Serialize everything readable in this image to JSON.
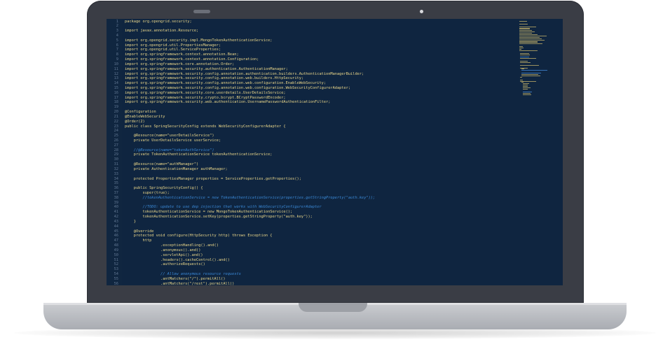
{
  "lines": [
    [
      "1",
      "package org.opengrid.security;",
      "code"
    ],
    [
      "2",
      "",
      "code"
    ],
    [
      "3",
      "import javax.annotation.Resource;",
      "code"
    ],
    [
      "4",
      "",
      "code"
    ],
    [
      "5",
      "import org.opengrid.security.impl.MongoTokenAuthenticationService;",
      "code"
    ],
    [
      "6",
      "import org.opengrid.util.PropertiesManager;",
      "code"
    ],
    [
      "7",
      "import org.opengrid.util.ServiceProperties;",
      "code"
    ],
    [
      "8",
      "import org.springframework.context.annotation.Bean;",
      "code"
    ],
    [
      "9",
      "import org.springframework.context.annotation.Configuration;",
      "code"
    ],
    [
      "10",
      "import org.springframework.core.annotation.Order;",
      "code"
    ],
    [
      "11",
      "import org.springframework.security.authentication.AuthenticationManager;",
      "code"
    ],
    [
      "12",
      "import org.springframework.security.config.annotation.authentication.builders.AuthenticationManagerBuilder;",
      "code"
    ],
    [
      "13",
      "import org.springframework.security.config.annotation.web.builders.HttpSecurity;",
      "code"
    ],
    [
      "14",
      "import org.springframework.security.config.annotation.web.configuration.EnableWebSecurity;",
      "code"
    ],
    [
      "15",
      "import org.springframework.security.config.annotation.web.configuration.WebSecurityConfigurerAdapter;",
      "code"
    ],
    [
      "16",
      "import org.springframework.security.core.userdetails.UserDetailsService;",
      "code"
    ],
    [
      "17",
      "import org.springframework.security.crypto.bcrypt.BCryptPasswordEncoder;",
      "code"
    ],
    [
      "18",
      "import org.springframework.security.web.authentication.UsernamePasswordAuthenticationFilter;",
      "code"
    ],
    [
      "19",
      "",
      "code"
    ],
    [
      "20",
      "@Configuration",
      "code"
    ],
    [
      "21",
      "@EnableWebSecurity",
      "code"
    ],
    [
      "22",
      "@Order(2)",
      "code"
    ],
    [
      "23",
      "public class SpringSecurityConfig extends WebSecurityConfigurerAdapter {",
      "code"
    ],
    [
      "24",
      "",
      "code"
    ],
    [
      "25",
      "    @Resource(name=\"userDetailsService\")",
      "code"
    ],
    [
      "26",
      "    private UserDetailsService userService;",
      "code"
    ],
    [
      "27",
      "",
      "code"
    ],
    [
      "28",
      "    //@Resource(name=\"tokenAuthService\")",
      "comment"
    ],
    [
      "29",
      "    private TokenAuthenticationService tokenAuthenticationService;",
      "code"
    ],
    [
      "30",
      "",
      "code"
    ],
    [
      "31",
      "    @Resource(name=\"authManager\")",
      "code"
    ],
    [
      "32",
      "    private AuthenticationManager authManager;",
      "code"
    ],
    [
      "33",
      "",
      "code"
    ],
    [
      "34",
      "    protected PropertiesManager properties = ServiceProperties.getProperties();",
      "code"
    ],
    [
      "35",
      "",
      "code"
    ],
    [
      "36",
      "    public SpringSecurityConfig() {",
      "code"
    ],
    [
      "37",
      "        super(true);",
      "code"
    ],
    [
      "38",
      "        //tokenAuthenticationService = new TokenAuthenticationService(properties.getStringProperty(\"auth.key\"));",
      "comment"
    ],
    [
      "39",
      "",
      "code"
    ],
    [
      "40",
      "        //TODO: update to use dep injection that works with WebSecurityConfigurerAdapter",
      "comment"
    ],
    [
      "41",
      "        tokenAuthenticationService = new MongoTokenAuthenticationService();",
      "code"
    ],
    [
      "42",
      "        tokenAuthenticationService.setKey(properties.getStringProperty(\"auth.key\"));",
      "code"
    ],
    [
      "43",
      "    }",
      "code"
    ],
    [
      "44",
      "",
      "code"
    ],
    [
      "45",
      "    @Override",
      "code"
    ],
    [
      "46",
      "    protected void configure(HttpSecurity http) throws Exception {",
      "code"
    ],
    [
      "47",
      "        http",
      "code"
    ],
    [
      "48",
      "                .exceptionHandling().and()",
      "code"
    ],
    [
      "49",
      "                .anonymous().and()",
      "code"
    ],
    [
      "50",
      "                .servletApi().and()",
      "code"
    ],
    [
      "51",
      "                .headers().cacheControl().and()",
      "code"
    ],
    [
      "52",
      "                .authorizeRequests()",
      "code"
    ],
    [
      "53",
      "",
      "code"
    ],
    [
      "54",
      "                // Allow anonymous resource requests",
      "comment"
    ],
    [
      "55",
      "                .antMatchers(\"/\").permitAll()",
      "code"
    ],
    [
      "56",
      "                .antMatchers(\"/rest\").permitAll()",
      "code"
    ]
  ],
  "colors": {
    "screen_bg": "#0f2540",
    "code_text": "#ecd88a",
    "comment_text": "#3b8ad8",
    "line_number": "#5f7590",
    "lid": "#3a3d45",
    "base": "#c2c4c9"
  }
}
